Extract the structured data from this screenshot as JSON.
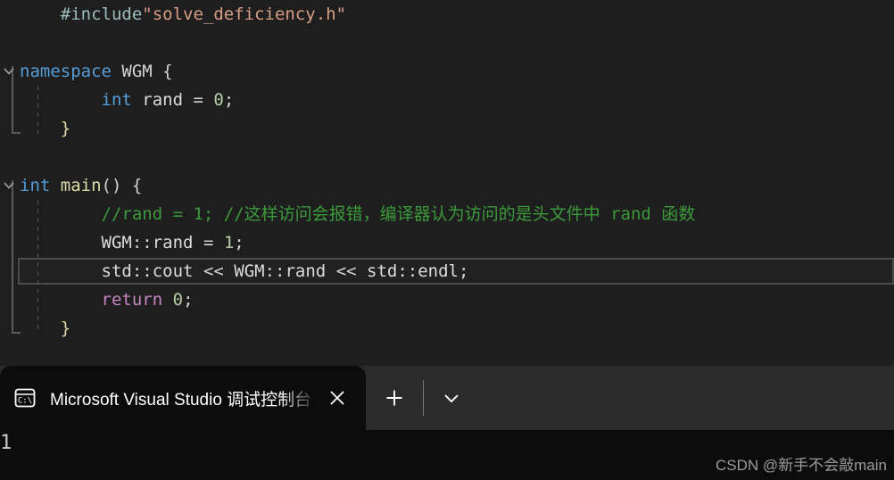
{
  "editor": {
    "background": "#1e1e1e",
    "current_line_index": 9,
    "lines": [
      {
        "indent": 1,
        "tokens": [
          {
            "text": "#include",
            "style": "t-pre"
          },
          {
            "text": "\"solve_deficiency.h\"",
            "style": "t-str"
          }
        ]
      },
      {
        "indent": 0,
        "tokens": []
      },
      {
        "indent": 0,
        "fold": "chevron-down",
        "tokens": [
          {
            "text": "namespace",
            "style": "t-kw"
          },
          {
            "text": " WGM {",
            "style": "t-plain"
          }
        ]
      },
      {
        "indent": 2,
        "tokens": [
          {
            "text": "int",
            "style": "t-kw"
          },
          {
            "text": " ",
            "style": "t-plain"
          },
          {
            "text": "rand",
            "style": "t-ident"
          },
          {
            "text": " = ",
            "style": "t-op"
          },
          {
            "text": "0",
            "style": "t-num"
          },
          {
            "text": ";",
            "style": "t-plain"
          }
        ]
      },
      {
        "indent": 1,
        "tokens": [
          {
            "text": "}",
            "style": "t-func"
          }
        ]
      },
      {
        "indent": 0,
        "tokens": []
      },
      {
        "indent": 0,
        "fold": "chevron-down",
        "tokens": [
          {
            "text": "int",
            "style": "t-kw"
          },
          {
            "text": " ",
            "style": "t-plain"
          },
          {
            "text": "main",
            "style": "t-func"
          },
          {
            "text": "() {",
            "style": "t-plain"
          }
        ]
      },
      {
        "indent": 2,
        "tokens": [
          {
            "text": "//rand = 1; //这样访问会报错，编译器认为访问的是头文件中 rand 函数",
            "style": "t-comment"
          }
        ]
      },
      {
        "indent": 2,
        "tokens": [
          {
            "text": "WGM",
            "style": "t-ident"
          },
          {
            "text": "::",
            "style": "t-plain"
          },
          {
            "text": "rand",
            "style": "t-ident"
          },
          {
            "text": " = ",
            "style": "t-op"
          },
          {
            "text": "1",
            "style": "t-num"
          },
          {
            "text": ";",
            "style": "t-plain"
          }
        ]
      },
      {
        "indent": 2,
        "tokens": [
          {
            "text": "std",
            "style": "t-ident"
          },
          {
            "text": "::",
            "style": "t-plain"
          },
          {
            "text": "cout",
            "style": "t-ident"
          },
          {
            "text": " << ",
            "style": "t-op"
          },
          {
            "text": "WGM",
            "style": "t-ident"
          },
          {
            "text": "::",
            "style": "t-plain"
          },
          {
            "text": "rand",
            "style": "t-ident"
          },
          {
            "text": " << ",
            "style": "t-op"
          },
          {
            "text": "std",
            "style": "t-ident"
          },
          {
            "text": "::",
            "style": "t-plain"
          },
          {
            "text": "endl",
            "style": "t-ident"
          },
          {
            "text": ";",
            "style": "t-plain"
          }
        ]
      },
      {
        "indent": 2,
        "tokens": [
          {
            "text": "return",
            "style": "t-kw2"
          },
          {
            "text": " ",
            "style": "t-plain"
          },
          {
            "text": "0",
            "style": "t-num"
          },
          {
            "text": ";",
            "style": "t-plain"
          }
        ]
      },
      {
        "indent": 1,
        "tokens": [
          {
            "text": "}",
            "style": "t-func"
          }
        ]
      }
    ]
  },
  "terminal": {
    "tab": {
      "icon": "command-prompt-icon",
      "title": "Microsoft Visual Studio 调试控制台",
      "close_label": "✕"
    },
    "new_tab_label": "+",
    "dropdown_label": "⌄",
    "output": "1",
    "watermark": "CSDN @新手不会敲main"
  }
}
